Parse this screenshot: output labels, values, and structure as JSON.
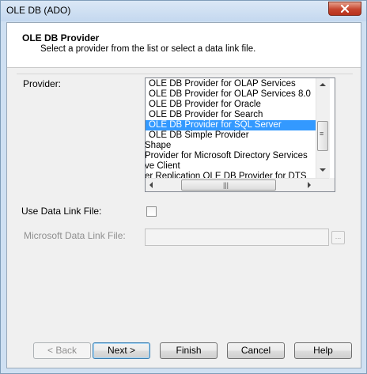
{
  "window": {
    "title": "OLE DB (ADO)"
  },
  "header": {
    "title": "OLE DB Provider",
    "subtitle": "Select a provider from the list or select a data link file."
  },
  "provider": {
    "label": "Provider:",
    "items": [
      {
        "label": "OLE DB Provider for OLAP Services",
        "selected": false
      },
      {
        "label": "OLE DB Provider for OLAP Services 8.0",
        "selected": false
      },
      {
        "label": "OLE DB Provider for Oracle",
        "selected": false
      },
      {
        "label": "OLE DB Provider for Search",
        "selected": false
      },
      {
        "label": "OLE DB Provider for SQL Server",
        "selected": true
      },
      {
        "label": "OLE DB Simple Provider",
        "selected": false
      },
      {
        "label": "Shape",
        "selected": false
      },
      {
        "label": "Provider for Microsoft Directory Services",
        "selected": false
      },
      {
        "label": "ve Client",
        "selected": false
      },
      {
        "label": "er Replication OLE DB Provider for DTS",
        "selected": false
      }
    ],
    "hscroll_grip": "|||",
    "vscroll_grip": "≡"
  },
  "data_link": {
    "use_label": "Use Data Link File:",
    "use_checked": false,
    "file_label": "Microsoft Data Link File:",
    "file_value": "",
    "browse_label": "..."
  },
  "buttons": {
    "back": "< Back",
    "next": "Next >",
    "finish": "Finish",
    "cancel": "Cancel",
    "help": "Help"
  },
  "colors": {
    "selection": "#3399ff",
    "chrome": "#cfe0f2",
    "close": "#c6452e"
  }
}
